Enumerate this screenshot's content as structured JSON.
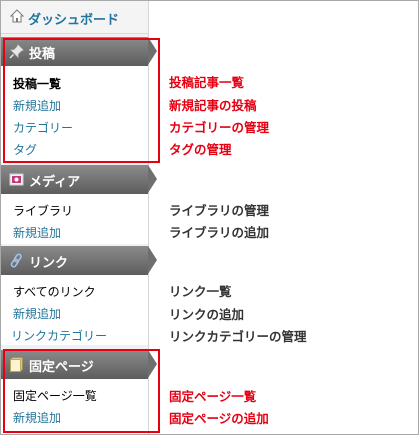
{
  "dashboard": {
    "label": "ダッシュボード",
    "icon": "home-icon"
  },
  "sections": {
    "posts": {
      "label": "投稿",
      "icon": "pin-icon",
      "items": [
        "投稿一覧",
        "新規追加",
        "カテゴリー",
        "タグ"
      ],
      "descriptions": [
        "投稿記事一覧",
        "新規記事の投稿",
        "カテゴリーの管理",
        "タグの管理"
      ]
    },
    "media": {
      "label": "メディア",
      "icon": "media-icon",
      "items": [
        "ライブラリ",
        "新規追加"
      ],
      "descriptions": [
        "ライブラリの管理",
        "ライブラリの追加"
      ]
    },
    "links": {
      "label": "リンク",
      "icon": "link-icon",
      "items": [
        "すべてのリンク",
        "新規追加",
        "リンクカテゴリー"
      ],
      "descriptions": [
        "リンク一覧",
        "リンクの追加",
        "リンクカテゴリーの管理"
      ]
    },
    "pages": {
      "label": "固定ページ",
      "icon": "pages-icon",
      "items": [
        "固定ページ一覧",
        "新規追加"
      ],
      "descriptions": [
        "固定ページ一覧",
        "固定ページの追加"
      ]
    }
  },
  "colors": {
    "highlight": "#e60012",
    "link": "#21759b",
    "header": "#6f6f6f"
  }
}
